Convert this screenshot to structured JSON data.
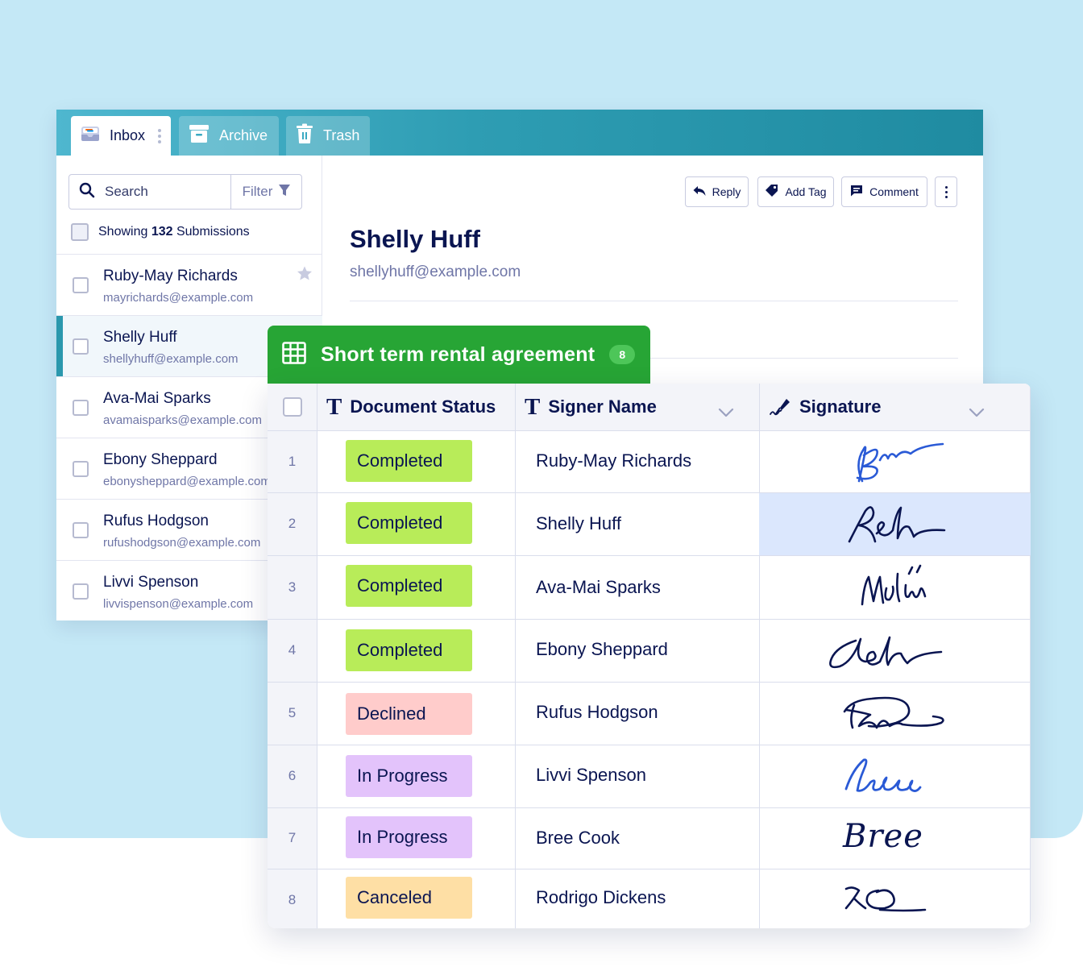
{
  "tabs": {
    "inbox": "Inbox",
    "archive": "Archive",
    "trash": "Trash"
  },
  "sidebar": {
    "search_placeholder": "Search",
    "filter_label": "Filter",
    "showing_prefix": "Showing ",
    "showing_count": "132",
    "showing_suffix": " Submissions",
    "items": [
      {
        "name": "Ruby-May Richards",
        "email": "mayrichards@example.com"
      },
      {
        "name": "Shelly Huff",
        "email": "shellyhuff@example.com"
      },
      {
        "name": "Ava-Mai Sparks",
        "email": "avamaisparks@example.com"
      },
      {
        "name": "Ebony Sheppard",
        "email": "ebonysheppard@example.com"
      },
      {
        "name": "Rufus Hodgson",
        "email": "rufushodgson@example.com"
      },
      {
        "name": "Livvi Spenson",
        "email": "livvispenson@example.com"
      }
    ]
  },
  "detail": {
    "reply": "Reply",
    "add_tag": "Add Tag",
    "comment": "Comment",
    "name": "Shelly Huff",
    "email": "shellyhuff@example.com"
  },
  "table": {
    "title": "Short term rental agreement",
    "count": "8",
    "columns": {
      "status": "Document Status",
      "signer": "Signer Name",
      "signature": "Signature"
    },
    "rows": [
      {
        "num": "1",
        "status": "Completed",
        "signer": "Ruby-May Richards"
      },
      {
        "num": "2",
        "status": "Completed",
        "signer": "Shelly Huff"
      },
      {
        "num": "3",
        "status": "Completed",
        "signer": "Ava-Mai Sparks"
      },
      {
        "num": "4",
        "status": "Completed",
        "signer": "Ebony Sheppard"
      },
      {
        "num": "5",
        "status": "Declined",
        "signer": "Rufus Hodgson"
      },
      {
        "num": "6",
        "status": "In Progress",
        "signer": "Livvi Spenson"
      },
      {
        "num": "7",
        "status": "In Progress",
        "signer": "Bree Cook"
      },
      {
        "num": "8",
        "status": "Canceled",
        "signer": "Rodrigo Dickens"
      }
    ],
    "signature_7_text": "Bree"
  },
  "colors": {
    "completed": "#b8ec59",
    "declined": "#ffcccb",
    "in_progress": "#e3c3fb",
    "canceled": "#fedfa5",
    "header_green": "#27a535",
    "teal": "#2b98ad",
    "ink_dark": "#0a1551",
    "ink_blue": "#2a5ad6"
  }
}
